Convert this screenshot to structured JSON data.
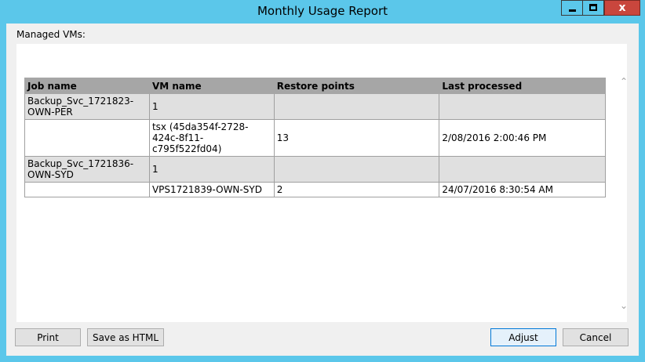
{
  "window": {
    "title": "Monthly Usage Report",
    "controls": {
      "minimize_icon": "minimize-icon",
      "maximize_icon": "maximize-icon",
      "close_label": "x"
    }
  },
  "managed_vms": {
    "label": "Managed VMs:",
    "columns": [
      "Job name",
      "VM name",
      "Restore points",
      "Last processed"
    ],
    "rows": [
      {
        "kind": "job",
        "cells": [
          "Backup_Svc_1721823-OWN-PER",
          "1",
          "",
          ""
        ]
      },
      {
        "kind": "vm",
        "cells": [
          "",
          "tsx (45da354f-2728-424c-8f11-c795f522fd04)",
          "13",
          "2/08/2016 2:00:46 PM"
        ]
      },
      {
        "kind": "job",
        "cells": [
          "Backup_Svc_1721836-OWN-SYD",
          "1",
          "",
          ""
        ]
      },
      {
        "kind": "vm",
        "cells": [
          "",
          "VPS1721839-OWN-SYD",
          "2",
          "24/07/2016 8:30:54 AM"
        ]
      }
    ]
  },
  "buttons": {
    "print": "Print",
    "save_html": "Save as HTML",
    "adjust": "Adjust",
    "cancel": "Cancel"
  },
  "colors": {
    "title_bar": "#5bc7ea",
    "close_button": "#c9463d",
    "header_row": "#a6a6a6",
    "job_row": "#e0e0e0"
  }
}
